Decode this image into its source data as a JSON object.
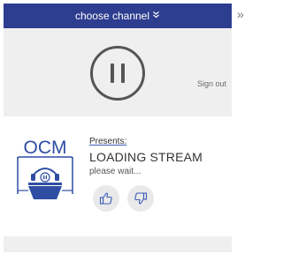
{
  "channel_bar": {
    "label": "choose channel",
    "chevron": "double-chevron-down-icon"
  },
  "player": {
    "state_icon": "pause-icon",
    "signout_label": "Sign out"
  },
  "stream": {
    "logo_text": "OCM",
    "presents_label": "Presents:",
    "title": "LOADING STREAM",
    "subtitle": "please wait..."
  },
  "votes": {
    "up_icon": "thumbs-up-icon",
    "down_icon": "thumbs-down-icon"
  },
  "side": {
    "expand_glyph": "»",
    "expand_icon": "double-chevron-right-icon"
  },
  "colors": {
    "bar": "#2d3d8f",
    "logo": "#2f4da3",
    "panel_grey": "#efefef",
    "vote_bg": "#e9e9e9"
  }
}
